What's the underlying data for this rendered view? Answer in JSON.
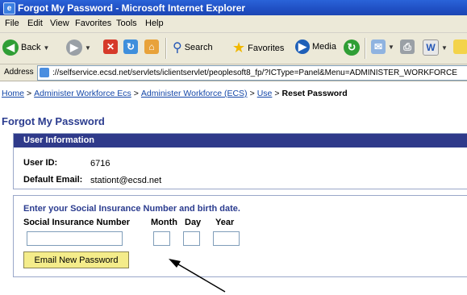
{
  "window": {
    "title": "Forgot My Password - Microsoft Internet Explorer"
  },
  "menubar": [
    "File",
    "Edit",
    "View",
    "Favorites",
    "Tools",
    "Help"
  ],
  "toolbar": {
    "back": "Back",
    "search": "Search",
    "favorites": "Favorites",
    "media": "Media"
  },
  "address": {
    "label": "Address",
    "url": "://selfservice.ecsd.net/servlets/iclientservlet/peoplesoft8_fp/?ICType=Panel&Menu=ADMINISTER_WORKFORCE"
  },
  "breadcrumb": {
    "items": [
      "Home",
      "Administer Workforce Ecs",
      "Administer Workforce (ECS)",
      "Use"
    ],
    "separator": ">",
    "current": "Reset Password"
  },
  "page": {
    "title": "Forgot My Password"
  },
  "user_info": {
    "header": "User Information",
    "user_id_label": "User ID:",
    "user_id_value": "6716",
    "email_label": "Default Email:",
    "email_value": "stationt@ecsd.net"
  },
  "sin_form": {
    "prompt": "Enter your Social Insurance Number and birth date.",
    "sin_label": "Social Insurance Number",
    "month_label": "Month",
    "day_label": "Day",
    "year_label": "Year",
    "sin_value": "",
    "month_value": "",
    "day_value": "",
    "year_value": "",
    "submit_label": "Email New Password"
  },
  "colors": {
    "title_bar": "#1f4fc3",
    "section_header": "#2f3a8a",
    "heading_text": "#2b3c8f",
    "link": "#1447a8",
    "button": "#f4ec8a"
  }
}
